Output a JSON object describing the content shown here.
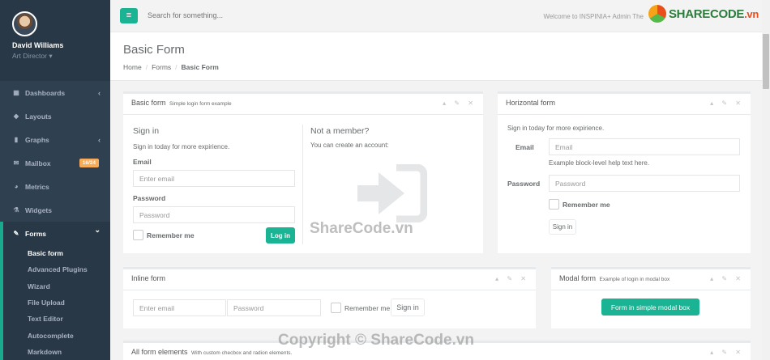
{
  "sidebar": {
    "profile": {
      "name": "David Williams",
      "role": "Art Director ▾"
    },
    "items": [
      {
        "label": "Dashboards",
        "icon": "dashboard-icon",
        "glyph": "▦",
        "caret": "‹"
      },
      {
        "label": "Layouts",
        "icon": "diamond-icon",
        "glyph": "◆",
        "caret": ""
      },
      {
        "label": "Graphs",
        "icon": "bar-chart-icon",
        "glyph": "▮",
        "caret": "‹"
      },
      {
        "label": "Mailbox",
        "icon": "envelope-icon",
        "glyph": "✉",
        "caret": "",
        "badge": "16/24"
      },
      {
        "label": "Metrics",
        "icon": "pie-chart-icon",
        "glyph": "◕",
        "caret": ""
      },
      {
        "label": "Widgets",
        "icon": "flask-icon",
        "glyph": "⚗",
        "caret": ""
      },
      {
        "label": "Forms",
        "icon": "edit-icon",
        "glyph": "✎",
        "caret": "⌄"
      }
    ],
    "subitems": [
      "Basic form",
      "Advanced Plugins",
      "Wizard",
      "File Upload",
      "Text Editor",
      "Autocomplete",
      "Markdown"
    ]
  },
  "topbar": {
    "search_placeholder": "Search for something...",
    "welcome": "Welcome to INSPINIA+ Admin The",
    "logo_main": "SHARECODE",
    "logo_suffix": ".vn"
  },
  "heading": {
    "title": "Basic Form",
    "crumbs": [
      "Home",
      "Forms",
      "Basic Form"
    ]
  },
  "basic_form": {
    "title": "Basic form",
    "subtitle": "Simple login form example",
    "signin_title": "Sign in",
    "signin_text": "Sign in today for more expirience.",
    "email_label": "Email",
    "email_placeholder": "Enter email",
    "password_label": "Password",
    "password_placeholder": "Password",
    "remember": "Remember me",
    "login_button": "Log in",
    "not_member_title": "Not a member?",
    "not_member_text": "You can create an account:"
  },
  "horizontal_form": {
    "title": "Horizontal form",
    "intro": "Sign in today for more expirience.",
    "email_label": "Email",
    "email_placeholder": "Email",
    "help_text": "Example block-level help text here.",
    "password_label": "Password",
    "password_placeholder": "Password",
    "remember": "Remember me",
    "signin_button": "Sign in"
  },
  "inline_form": {
    "title": "Inline form",
    "email_placeholder": "Enter email",
    "password_placeholder": "Password",
    "remember": "Remember me",
    "signin_button": "Sign in"
  },
  "modal_form": {
    "title": "Modal form",
    "subtitle": "Example of login in modal box",
    "button": "Form in simple modal box"
  },
  "all_elements": {
    "title": "All form elements",
    "subtitle": "With custom checbox and radion elements."
  },
  "panel_tools": "▴ ✎ ✕",
  "watermarks": {
    "center": "ShareCode.vn",
    "bottom": "Copyright © ShareCode.vn"
  }
}
